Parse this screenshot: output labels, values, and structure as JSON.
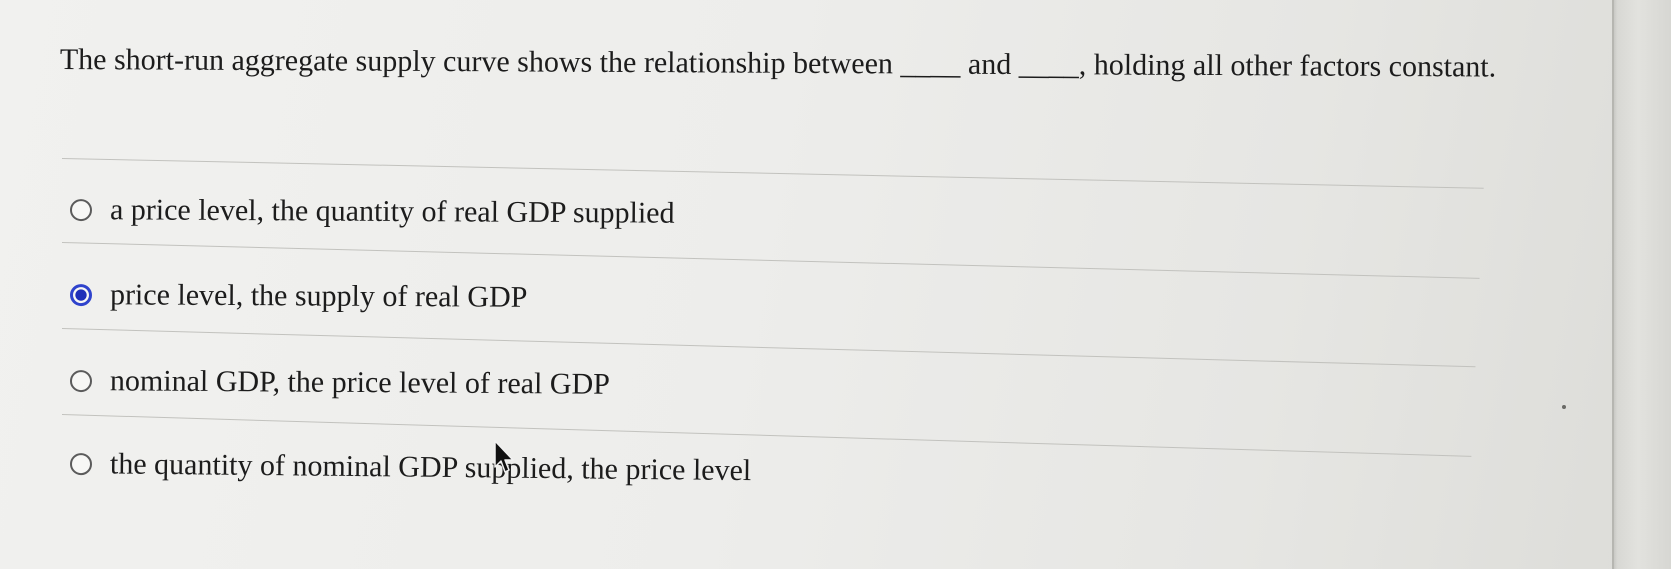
{
  "question": {
    "part1": "The short-run aggregate supply curve shows the relationship between ",
    "blank1": "____",
    "part2": " and ",
    "blank2": "____",
    "part3": ", holding all other factors constant."
  },
  "options": [
    {
      "label": "a price level, the quantity of real GDP supplied",
      "selected": false
    },
    {
      "label": "price level, the supply of real GDP",
      "selected": true
    },
    {
      "label": "nominal GDP, the price level of real GDP",
      "selected": false
    },
    {
      "label": "the quantity of nominal GDP supplied, the price level",
      "selected": false
    }
  ],
  "colors": {
    "accent": "#2f43cc",
    "text": "#1c1c1c",
    "background": "#ededeb"
  },
  "icons": {
    "radio_unselected": "radio-empty-icon",
    "radio_selected": "radio-filled-icon",
    "cursor": "mouse-pointer-icon"
  }
}
